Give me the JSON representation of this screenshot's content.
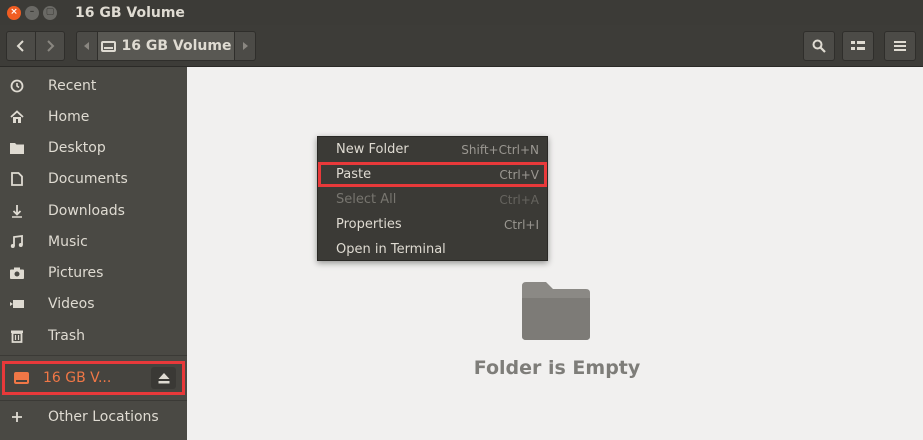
{
  "window": {
    "title": "16 GB Volume",
    "close_glyph": "×",
    "min_glyph": "–",
    "max_glyph": "▢"
  },
  "header": {
    "back_icon": "chevron-left-icon",
    "forward_icon": "chevron-right-icon",
    "breadcrumb_label": "16 GB Volume",
    "search_icon": "search-icon",
    "view_icon": "view-options-icon",
    "menu_icon": "hamburger-menu-icon"
  },
  "sidebar": {
    "items": [
      {
        "label": "Recent",
        "icon": "clock-icon"
      },
      {
        "label": "Home",
        "icon": "home-icon"
      },
      {
        "label": "Desktop",
        "icon": "folder-icon"
      },
      {
        "label": "Documents",
        "icon": "document-icon"
      },
      {
        "label": "Downloads",
        "icon": "download-icon"
      },
      {
        "label": "Music",
        "icon": "music-icon"
      },
      {
        "label": "Pictures",
        "icon": "camera-icon"
      },
      {
        "label": "Videos",
        "icon": "video-icon"
      },
      {
        "label": "Trash",
        "icon": "trash-icon"
      }
    ],
    "volume": {
      "label": "16 GB V...",
      "icon": "drive-icon",
      "eject_icon": "eject-icon"
    },
    "other_locations": {
      "label": "Other Locations",
      "icon": "plus-icon"
    }
  },
  "main": {
    "empty_text": "Folder is Empty",
    "empty_icon": "empty-folder-icon"
  },
  "context_menu": {
    "items": [
      {
        "label": "New Folder",
        "accel": "Shift+Ctrl+N",
        "enabled": true
      },
      {
        "label": "Paste",
        "accel": "Ctrl+V",
        "enabled": true
      },
      {
        "label": "Select All",
        "accel": "Ctrl+A",
        "enabled": false
      },
      {
        "label": "Properties",
        "accel": "Ctrl+I",
        "enabled": true
      },
      {
        "label": "Open in Terminal",
        "accel": "",
        "enabled": true
      }
    ]
  },
  "colors": {
    "accent_orange": "#f07746",
    "highlight_red": "#e8393a",
    "sidebar_bg": "#4a4944",
    "content_bg": "#f1f0ef"
  }
}
